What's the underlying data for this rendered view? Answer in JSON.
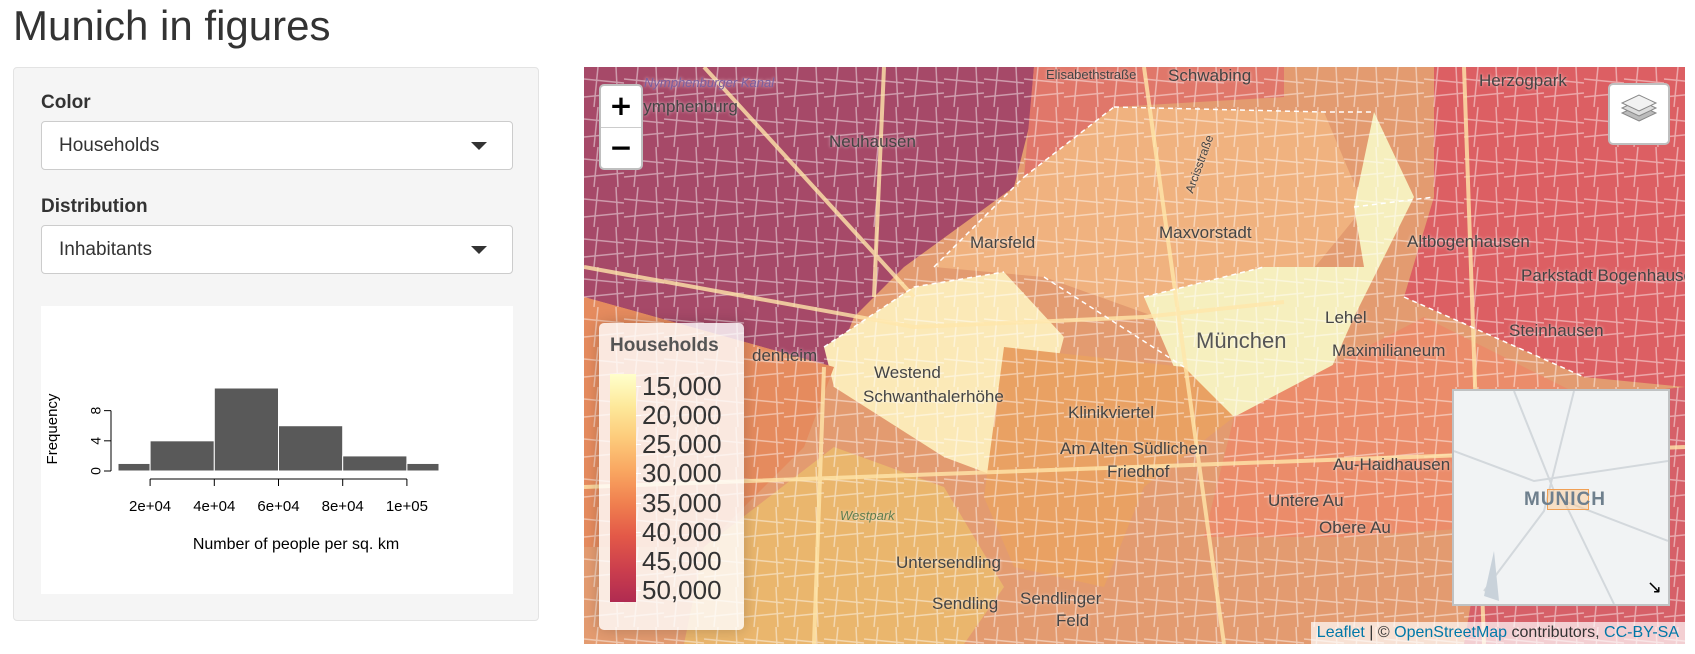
{
  "page": {
    "title": "Munich in figures"
  },
  "controls": {
    "color_label": "Color",
    "color_value": "Households",
    "distribution_label": "Distribution",
    "distribution_value": "Inhabitants"
  },
  "chart_data": {
    "type": "bar",
    "title": "",
    "xlabel": "Number of people per sq. km",
    "ylabel": "Frequency",
    "x_ticks": [
      "2e+04",
      "4e+04",
      "6e+04",
      "8e+04",
      "1e+05"
    ],
    "y_ticks": [
      "0",
      "4",
      "8"
    ],
    "bins": [
      {
        "from": 10000,
        "to": 20000,
        "count": 1
      },
      {
        "from": 20000,
        "to": 40000,
        "count": 4
      },
      {
        "from": 40000,
        "to": 60000,
        "count": 11
      },
      {
        "from": 60000,
        "to": 80000,
        "count": 6
      },
      {
        "from": 80000,
        "to": 100000,
        "count": 2
      },
      {
        "from": 100000,
        "to": 110000,
        "count": 1
      }
    ],
    "xlim": [
      10000,
      110000
    ],
    "ylim": [
      0,
      11
    ],
    "bar_color": "#595959"
  },
  "map": {
    "zoom_in": "+",
    "zoom_out": "−",
    "legend": {
      "title": "Households",
      "labels": [
        "15,000",
        "20,000",
        "25,000",
        "30,000",
        "35,000",
        "40,000",
        "45,000",
        "50,000"
      ],
      "colors": [
        "#ffffcc",
        "#b02b51"
      ]
    },
    "places": [
      {
        "name": "Schwabing",
        "big": false
      },
      {
        "name": "Nymphenburg",
        "big": false
      },
      {
        "name": "Neuhausen",
        "big": false
      },
      {
        "name": "Herzogpark",
        "big": false
      },
      {
        "name": "Marsfeld",
        "big": false
      },
      {
        "name": "Maxvorstadt",
        "big": false
      },
      {
        "name": "Altbogenhausen",
        "big": false
      },
      {
        "name": "Parkstadt Bogenhausen",
        "big": false
      },
      {
        "name": "Lehel",
        "big": false
      },
      {
        "name": "Steinhausen",
        "big": false
      },
      {
        "name": "München",
        "big": true
      },
      {
        "name": "Maximilianeum",
        "big": false
      },
      {
        "name": "Westend",
        "big": false
      },
      {
        "name": "Schwanthalerhöhe",
        "big": false
      },
      {
        "name": "Klinikviertel",
        "big": false
      },
      {
        "name": "Am Alten Südlichen",
        "big": false
      },
      {
        "name": "Friedhof",
        "big": false
      },
      {
        "name": "Au-Haidhausen",
        "big": false
      },
      {
        "name": "Untere Au",
        "big": false
      },
      {
        "name": "Obere Au",
        "big": false
      },
      {
        "name": "Untersendling",
        "big": false
      },
      {
        "name": "Sendling",
        "big": false
      },
      {
        "name": "Sendlinger",
        "big": false
      },
      {
        "name": "Feld",
        "big": false
      },
      {
        "name": "Westpark",
        "big": false
      },
      {
        "name": "Nymphenburger Kanal",
        "big": false
      },
      {
        "name": "Elisabethstraße",
        "big": false
      },
      {
        "name": "Arcisstraße",
        "big": false
      },
      {
        "name": "denheim",
        "big": false
      }
    ],
    "minimap_label": "MUNICH",
    "minimap_toggle_icon": "↘",
    "attribution": {
      "leaflet": "Leaflet",
      "sep": " | © ",
      "osm": "OpenStreetMap",
      "contrib": " contributors, ",
      "license": "CC-BY-SA"
    }
  }
}
